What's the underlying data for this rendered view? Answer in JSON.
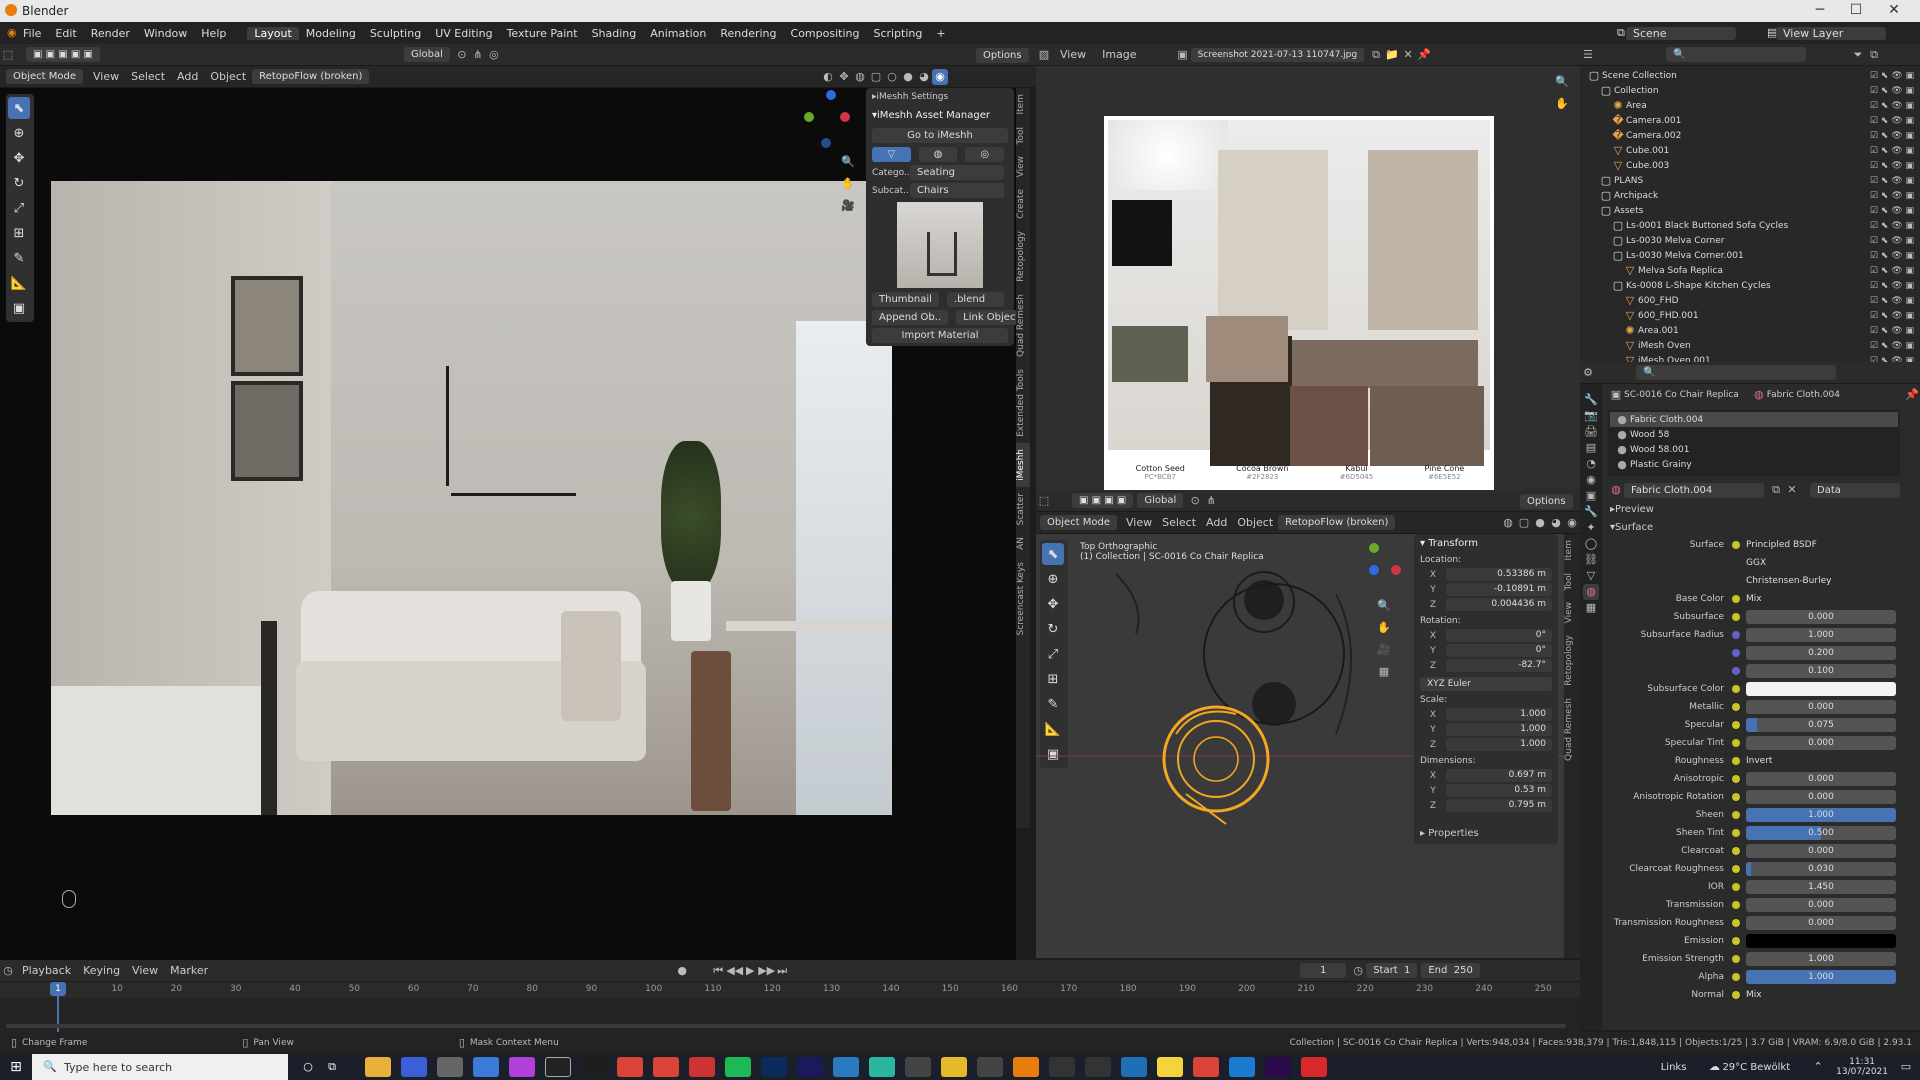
{
  "app": {
    "title": "Blender"
  },
  "menu": [
    "File",
    "Edit",
    "Render",
    "Window",
    "Help"
  ],
  "workspaces": [
    "Layout",
    "Modeling",
    "Sculpting",
    "UV Editing",
    "Texture Paint",
    "Shading",
    "Animation",
    "Rendering",
    "Compositing",
    "Scripting"
  ],
  "scene": {
    "label": "Scene",
    "view_layer": "View Layer"
  },
  "viewport_main": {
    "mode": "Object Mode",
    "menus": [
      "View",
      "Select",
      "Add",
      "Object"
    ],
    "addon": "RetopoFlow (broken)",
    "orientation": "Global",
    "options": "Options"
  },
  "imeshh": {
    "settings": "iMeshh Settings",
    "asset_manager": "iMeshh Asset Manager",
    "goto": "Go to iMeshh",
    "category_label": "Catego..",
    "category": "Seating",
    "subcat_label": "Subcat..",
    "subcat": "Chairs",
    "thumbnail": "Thumbnail",
    "blend": ".blend",
    "append": "Append Ob..",
    "link": "Link Object",
    "import_material": "Import Material"
  },
  "side_tabs": [
    "Item",
    "Tool",
    "View",
    "Create",
    "Retopology",
    "Quad Remesh",
    "Extended Tools",
    "iMeshh",
    "Scatter",
    "AN",
    "Screencast Keys"
  ],
  "image_editor": {
    "menus": [
      "View",
      "Image"
    ],
    "file": "Screenshot 2021-07-13 110747.jpg",
    "swatches": [
      {
        "name": "Cotton Seed",
        "code": "PC*BCB7",
        "color": "#bfbcb5"
      },
      {
        "name": "Cocoa Brown",
        "code": "#2F2823",
        "color": "#2f2823"
      },
      {
        "name": "Kabul",
        "code": "#6D5045",
        "color": "#6d5045"
      },
      {
        "name": "Pine Cone",
        "code": "#6E5E52",
        "color": "#6e5e52"
      }
    ]
  },
  "outliner": {
    "items": [
      {
        "label": "Scene Collection",
        "indent": 0,
        "icon": "collection"
      },
      {
        "label": "Collection",
        "indent": 1,
        "icon": "collection"
      },
      {
        "label": "Area",
        "indent": 2,
        "icon": "light"
      },
      {
        "label": "Camera.001",
        "indent": 2,
        "icon": "camera"
      },
      {
        "label": "Camera.002",
        "indent": 2,
        "icon": "camera"
      },
      {
        "label": "Cube.001",
        "indent": 2,
        "icon": "mesh"
      },
      {
        "label": "Cube.003",
        "indent": 2,
        "icon": "mesh"
      },
      {
        "label": "PLANS",
        "indent": 1,
        "icon": "collection"
      },
      {
        "label": "Archipack",
        "indent": 1,
        "icon": "collection"
      },
      {
        "label": "Assets",
        "indent": 1,
        "icon": "collection"
      },
      {
        "label": "Ls-0001 Black Buttoned Sofa Cycles",
        "indent": 2,
        "icon": "collection"
      },
      {
        "label": "Ls-0030 Melva Corner",
        "indent": 2,
        "icon": "collection"
      },
      {
        "label": "Ls-0030 Melva Corner.001",
        "indent": 2,
        "icon": "collection"
      },
      {
        "label": "Melva Sofa Replica",
        "indent": 3,
        "icon": "mesh"
      },
      {
        "label": "Ks-0008 L-Shape Kitchen Cycles",
        "indent": 2,
        "icon": "collection"
      },
      {
        "label": "600_FHD",
        "indent": 3,
        "icon": "mesh"
      },
      {
        "label": "600_FHD.001",
        "indent": 3,
        "icon": "mesh"
      },
      {
        "label": "Area.001",
        "indent": 3,
        "icon": "light"
      },
      {
        "label": "iMesh Oven",
        "indent": 3,
        "icon": "mesh"
      },
      {
        "label": "iMesh Oven.001",
        "indent": 3,
        "icon": "mesh"
      }
    ]
  },
  "viewport_top": {
    "mode": "Object Mode",
    "menus": [
      "View",
      "Select",
      "Add",
      "Object"
    ],
    "addon": "RetopoFlow (broken)",
    "orientation": "Global",
    "options": "Options",
    "view_name": "Top Orthographic",
    "selection": "(1) Collection | SC-0016 Co Chair Replica"
  },
  "transform": {
    "title": "Transform",
    "location_label": "Location:",
    "location": {
      "x": "0.53386 m",
      "y": "-0.10891 m",
      "z": "0.004436 m"
    },
    "rotation_label": "Rotation:",
    "rotation": {
      "x": "0°",
      "y": "0°",
      "z": "-82.7°"
    },
    "euler": "XYZ Euler",
    "scale_label": "Scale:",
    "scale": {
      "x": "1.000",
      "y": "1.000",
      "z": "1.000"
    },
    "dimensions_label": "Dimensions:",
    "dimensions": {
      "x": "0.697 m",
      "y": "0.53 m",
      "z": "0.795 m"
    },
    "properties": "Properties"
  },
  "properties": {
    "object": "SC-0016 Co Chair Replica",
    "material": "Fabric Cloth.004",
    "slots": [
      "Fabric Cloth.004",
      "Wood 58",
      "Wood 58.001",
      "Plastic Grainy"
    ],
    "datablock": "Fabric Cloth.004",
    "data": "Data",
    "preview": "Preview",
    "surface_section": "Surface",
    "rows": [
      {
        "label": "Surface",
        "value": "Principled BSDF",
        "kind": "link"
      },
      {
        "label": "",
        "value": "GGX",
        "kind": "menu"
      },
      {
        "label": "",
        "value": "Christensen-Burley",
        "kind": "menu"
      },
      {
        "label": "Base Color",
        "value": "Mix",
        "kind": "link"
      },
      {
        "label": "Subsurface",
        "value": "0.000",
        "kind": "num",
        "fill": 0
      },
      {
        "label": "Subsurface Radius",
        "value": "1.000",
        "kind": "num",
        "fill": 0
      },
      {
        "label": "",
        "value": "0.200",
        "kind": "num",
        "fill": 0
      },
      {
        "label": "",
        "value": "0.100",
        "kind": "num",
        "fill": 0
      },
      {
        "label": "Subsurface Color",
        "value": "",
        "kind": "color",
        "swatch": "#f2f2f2"
      },
      {
        "label": "Metallic",
        "value": "0.000",
        "kind": "num",
        "fill": 0
      },
      {
        "label": "Specular",
        "value": "0.075",
        "kind": "num",
        "fill": 0.075
      },
      {
        "label": "Specular Tint",
        "value": "0.000",
        "kind": "num",
        "fill": 0
      },
      {
        "label": "Roughness",
        "value": "Invert",
        "kind": "link"
      },
      {
        "label": "Anisotropic",
        "value": "0.000",
        "kind": "num",
        "fill": 0
      },
      {
        "label": "Anisotropic Rotation",
        "value": "0.000",
        "kind": "num",
        "fill": 0
      },
      {
        "label": "Sheen",
        "value": "1.000",
        "kind": "num",
        "fill": 1
      },
      {
        "label": "Sheen Tint",
        "value": "0.500",
        "kind": "num",
        "fill": 0.5
      },
      {
        "label": "Clearcoat",
        "value": "0.000",
        "kind": "num",
        "fill": 0
      },
      {
        "label": "Clearcoat Roughness",
        "value": "0.030",
        "kind": "num",
        "fill": 0.03
      },
      {
        "label": "IOR",
        "value": "1.450",
        "kind": "num",
        "fill": 0
      },
      {
        "label": "Transmission",
        "value": "0.000",
        "kind": "num",
        "fill": 0
      },
      {
        "label": "Transmission Roughness",
        "value": "0.000",
        "kind": "num",
        "fill": 0
      },
      {
        "label": "Emission",
        "value": "",
        "kind": "color",
        "swatch": "#000000"
      },
      {
        "label": "Emission Strength",
        "value": "1.000",
        "kind": "num",
        "fill": 0
      },
      {
        "label": "Alpha",
        "value": "1.000",
        "kind": "num",
        "fill": 1
      },
      {
        "label": "Normal",
        "value": "Mix",
        "kind": "link"
      }
    ]
  },
  "timeline": {
    "menus": [
      "Playback",
      "Keying",
      "View",
      "Marker"
    ],
    "current": "1",
    "start_label": "Start",
    "start": "1",
    "end_label": "End",
    "end": "250",
    "ticks": [
      "1",
      "10",
      "20",
      "30",
      "40",
      "50",
      "60",
      "70",
      "80",
      "90",
      "100",
      "110",
      "120",
      "130",
      "140",
      "150",
      "160",
      "170",
      "180",
      "190",
      "200",
      "210",
      "220",
      "230",
      "240",
      "250"
    ]
  },
  "statusbar": {
    "left": "Change Frame",
    "mid": "Pan View",
    "mid2": "Mask Context Menu",
    "right": "Collection | SC-0016 Co Chair Replica | Verts:948,034 | Faces:938,379 | Tris:1,848,115 | Objects:1/25 | 3.7 GiB | VRAM: 6.9/8.0 GiB | 2.93.1"
  },
  "taskbar": {
    "search": "Type here to search",
    "links": "Links",
    "weather": "29°C  Bewölkt",
    "time": "11:31",
    "date": "13/07/2021"
  },
  "colors": {
    "accent": "#4772b3",
    "selection": "#f5a623",
    "bg": "#1d1d1d"
  }
}
